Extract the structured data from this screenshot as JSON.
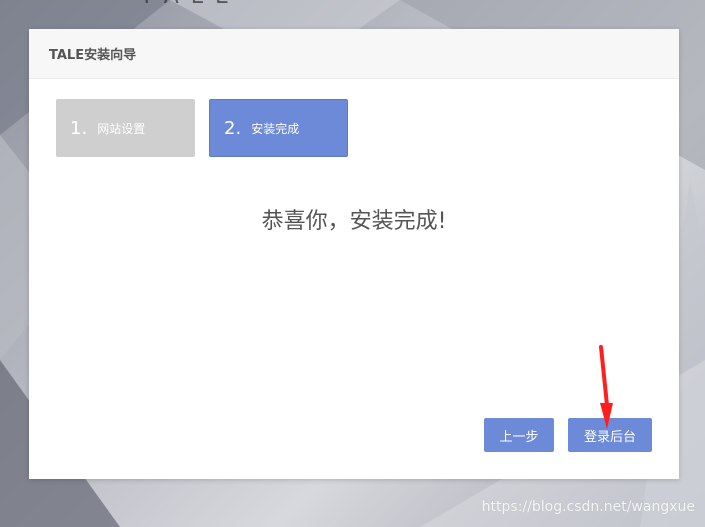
{
  "page_top_text": "TALE",
  "panel": {
    "title": "TALE安装向导"
  },
  "steps": [
    {
      "number": "1.",
      "label": "网站设置",
      "state": "inactive"
    },
    {
      "number": "2.",
      "label": "安装完成",
      "state": "active"
    }
  ],
  "message": "恭喜你，安装完成!",
  "buttons": {
    "prev": "上一步",
    "login": "登录后台"
  },
  "annotation": {
    "arrow_color": "#ff1f1f"
  },
  "watermark": "https://blog.csdn.net/wangxue",
  "colors": {
    "accent": "#6d8ad9",
    "inactive_step": "#cfcfcf",
    "header_bg": "#f7f7f7",
    "text": "#555555"
  }
}
